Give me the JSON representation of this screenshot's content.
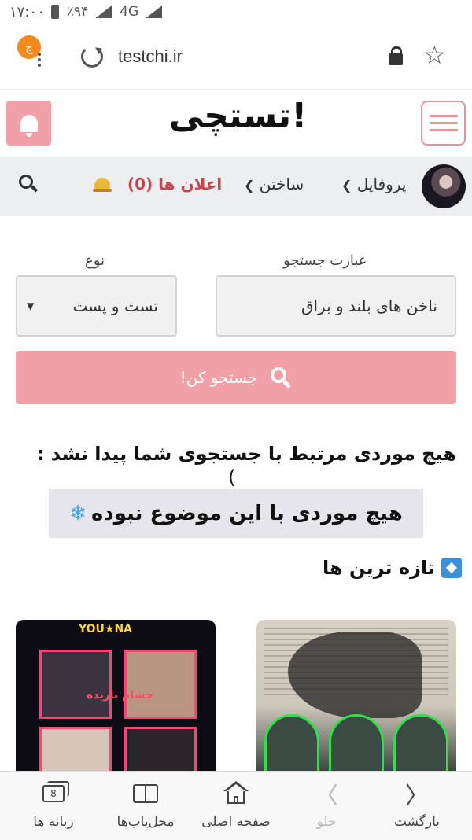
{
  "status_bar": {
    "time": "۱۷:۰۰",
    "battery": "٪۹۴",
    "network": "4G"
  },
  "browser": {
    "url": "testchi.ir",
    "tab_badge": "ج"
  },
  "site": {
    "logo": "تستچی!"
  },
  "nav": {
    "profile_label": "پروفایل",
    "build_label": "ساختن",
    "announcements_label": "اعلان ها (0)"
  },
  "search": {
    "term_label": "عبارت جستجو",
    "term_value": "ناخن های بلند و براق",
    "type_label": "نوع",
    "type_value": "تست و پست",
    "button_label": "جستجو کن!"
  },
  "results": {
    "no_result_text": "هیچ موردی مرتبط با جستجوی شما پیدا نشد :",
    "no_result_tail": "(",
    "highlight_text": "هیچ موردی با این موضوع نبوده"
  },
  "latest": {
    "title": "تازه ترین ها",
    "card_left_top": "YOU★NA",
    "card_left_caption": "چشام باریده"
  },
  "bottom_nav": {
    "back": "بازگشت",
    "forward": "جلو",
    "home": "صفحه اصلی",
    "bookmarks": "محل‌یاب‌ها",
    "tabs": "زبانه ها",
    "tabs_count": "8"
  },
  "colors": {
    "accent_pink": "#f0a0a6",
    "announce_red": "#c2474f",
    "nav_bg": "#eceeef"
  }
}
